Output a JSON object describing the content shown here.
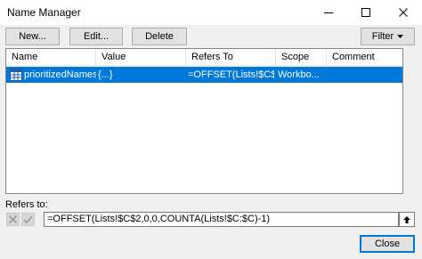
{
  "window": {
    "title": "Name Manager"
  },
  "toolbar": {
    "new_label": "New...",
    "edit_label": "Edit...",
    "delete_label": "Delete",
    "filter_label": "Filter"
  },
  "list": {
    "columns": [
      "Name",
      "Value",
      "Refers To",
      "Scope",
      "Comment"
    ],
    "rows": [
      {
        "name": "prioritizedNames",
        "value": "{...}",
        "refers_to": "=OFFSET(Lists!$C$...",
        "scope": "Workbo...",
        "comment": ""
      }
    ]
  },
  "refers": {
    "label": "Refers to:",
    "formula": "=OFFSET(Lists!$C$2,0,0,COUNTA(Lists!$C:$C)-1)"
  },
  "footer": {
    "close_label": "Close"
  },
  "colors": {
    "selection": "#0078d7",
    "dialog_bg": "#f0f0f0"
  }
}
